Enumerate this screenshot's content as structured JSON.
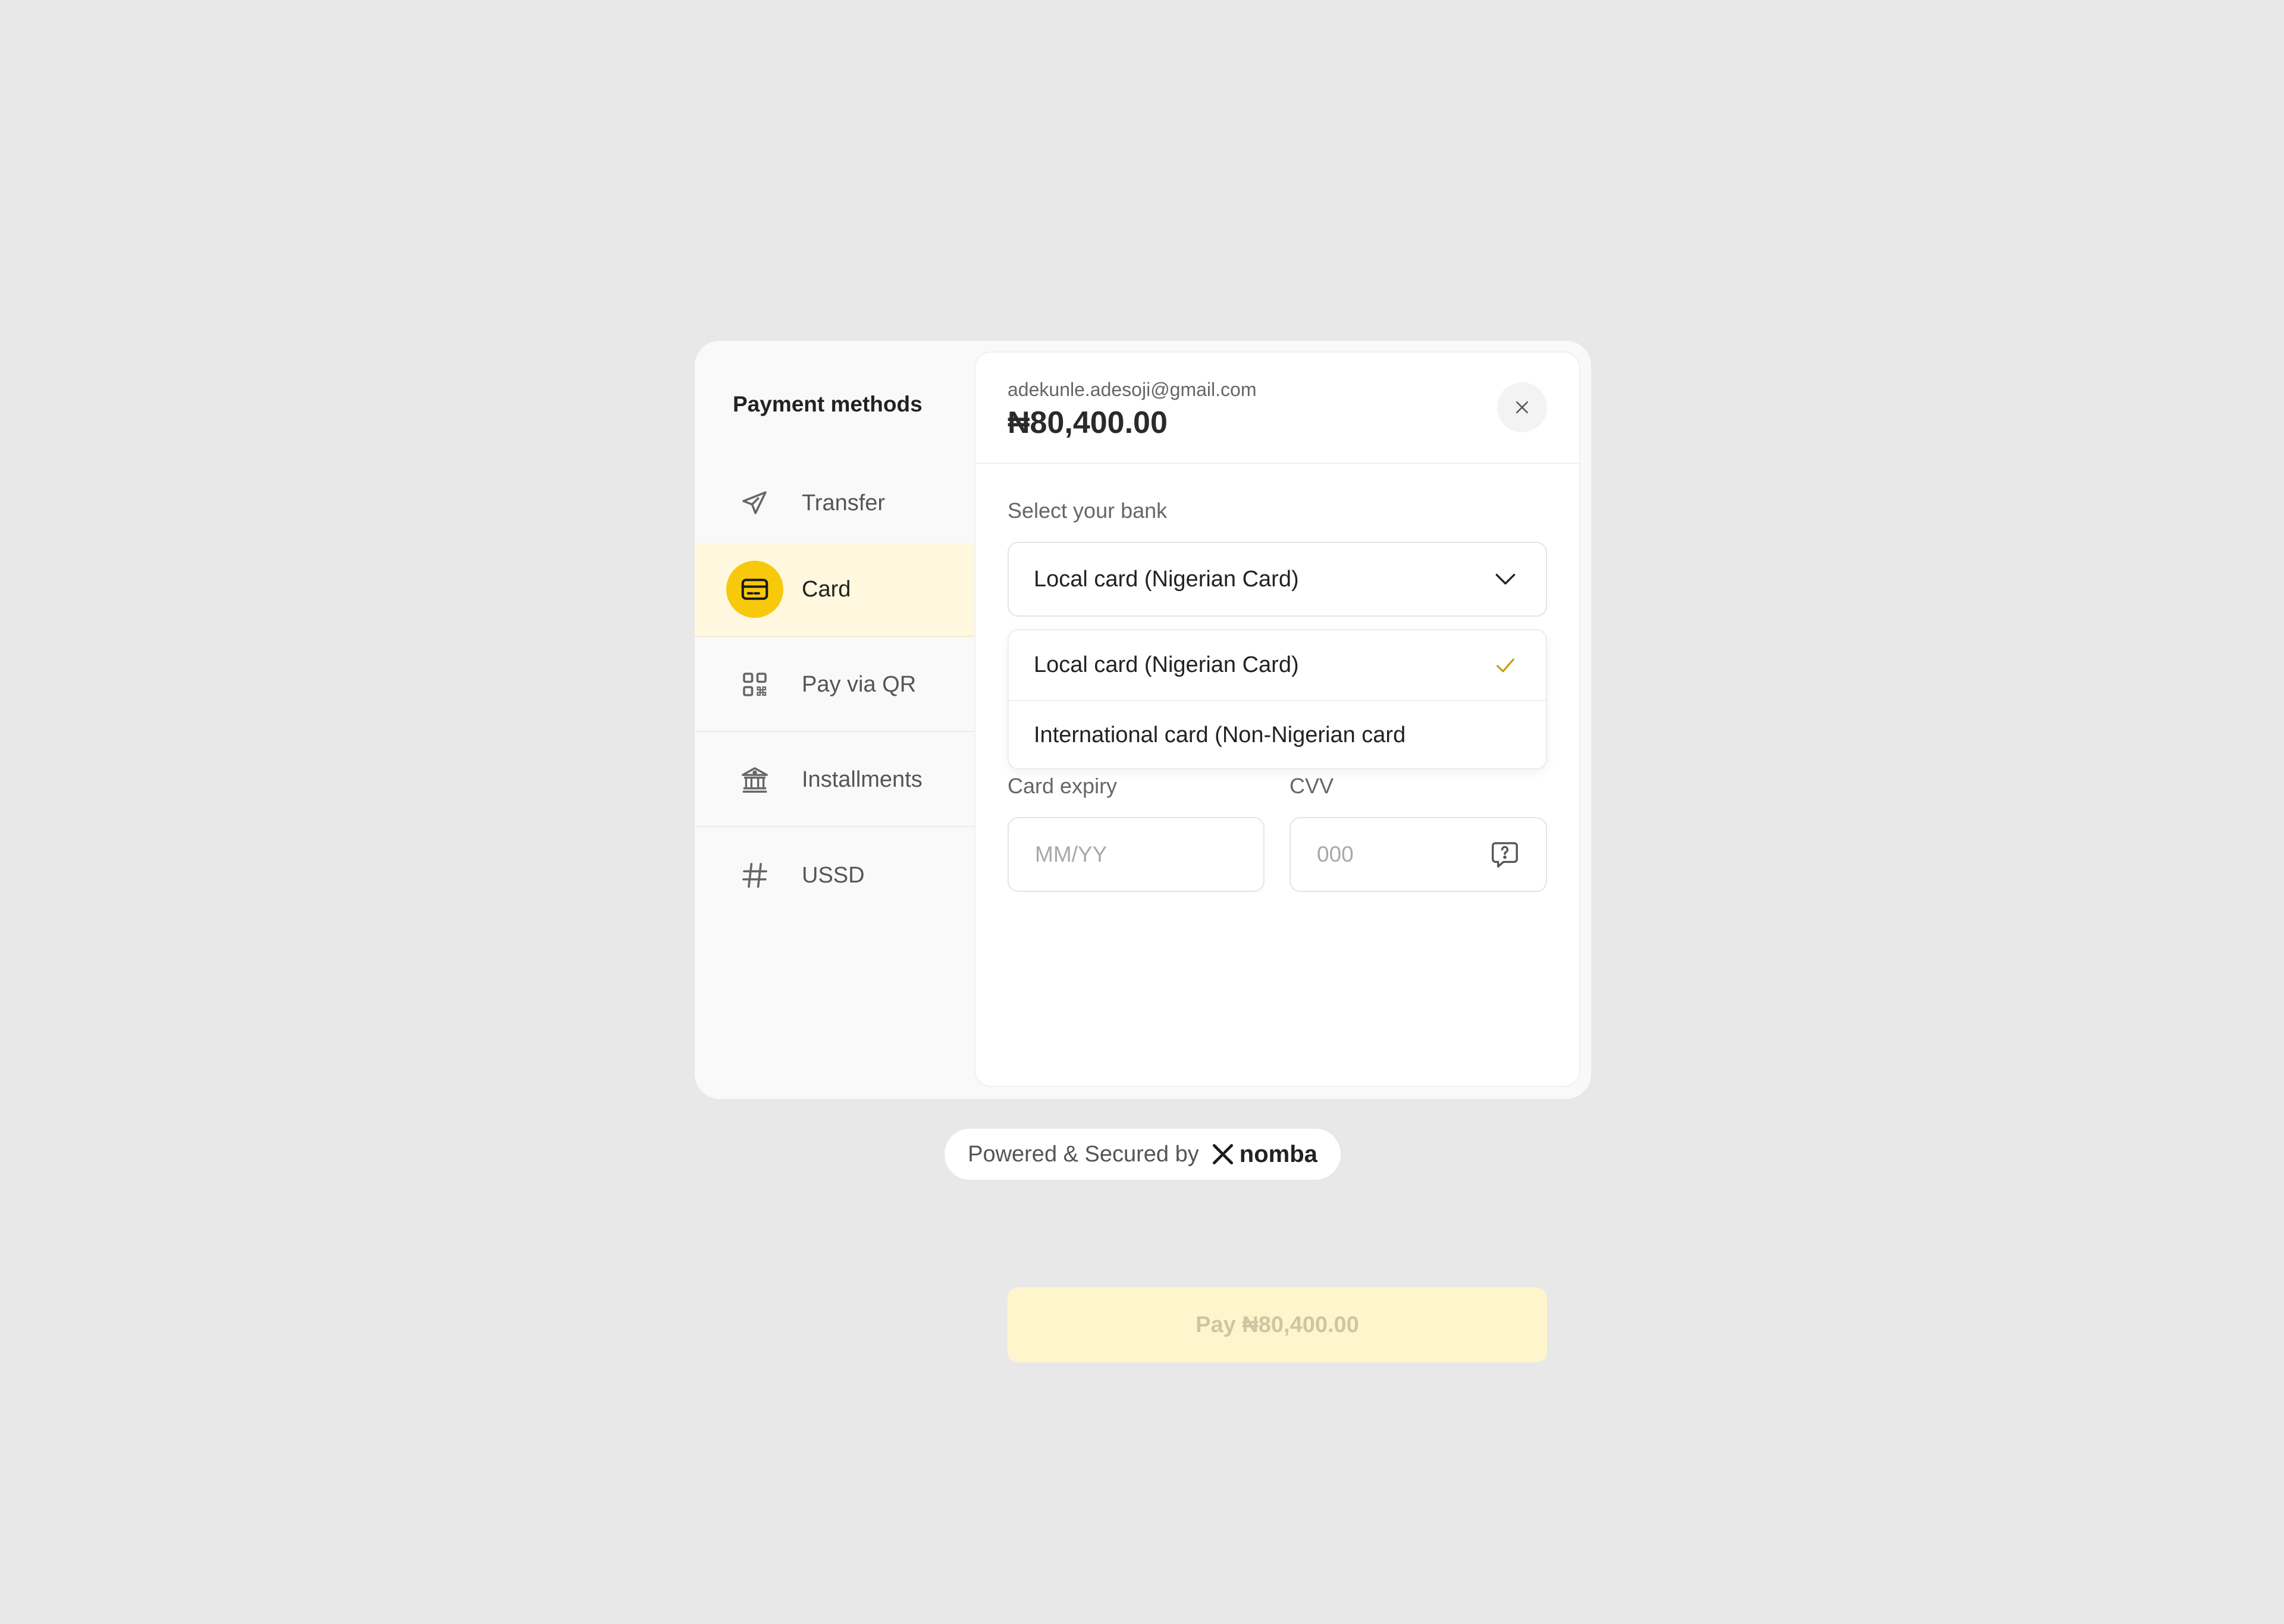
{
  "sidebar": {
    "title": "Payment methods",
    "items": [
      {
        "label": "Transfer",
        "icon": "send-icon",
        "active": false
      },
      {
        "label": "Card",
        "icon": "card-icon",
        "active": true
      },
      {
        "label": "Pay via QR",
        "icon": "qr-icon",
        "active": false
      },
      {
        "label": "Installments",
        "icon": "bank-icon",
        "active": false
      },
      {
        "label": "USSD",
        "icon": "hash-icon",
        "active": false
      }
    ]
  },
  "header": {
    "email": "adekunle.adesoji@gmail.com",
    "amount": "₦80,400.00"
  },
  "form": {
    "bank_label": "Select your bank",
    "bank_selected": "Local card (Nigerian Card)",
    "bank_options": [
      {
        "label": "Local card (Nigerian Card)",
        "selected": true
      },
      {
        "label": "International card (Non-Nigerian card",
        "selected": false
      }
    ],
    "expiry_label": "Card expiry",
    "expiry_placeholder": "MM/YY",
    "cvv_label": "CVV",
    "cvv_placeholder": "000",
    "pay_label": "Pay ₦80,400.00"
  },
  "footer": {
    "text": "Powered & Secured by",
    "brand": "nomba"
  },
  "colors": {
    "accent": "#f8c90b",
    "active_bg": "#fff8df",
    "pay_disabled_bg": "#fff5cc",
    "check": "#c79a00",
    "background": "#e8e8e8"
  }
}
